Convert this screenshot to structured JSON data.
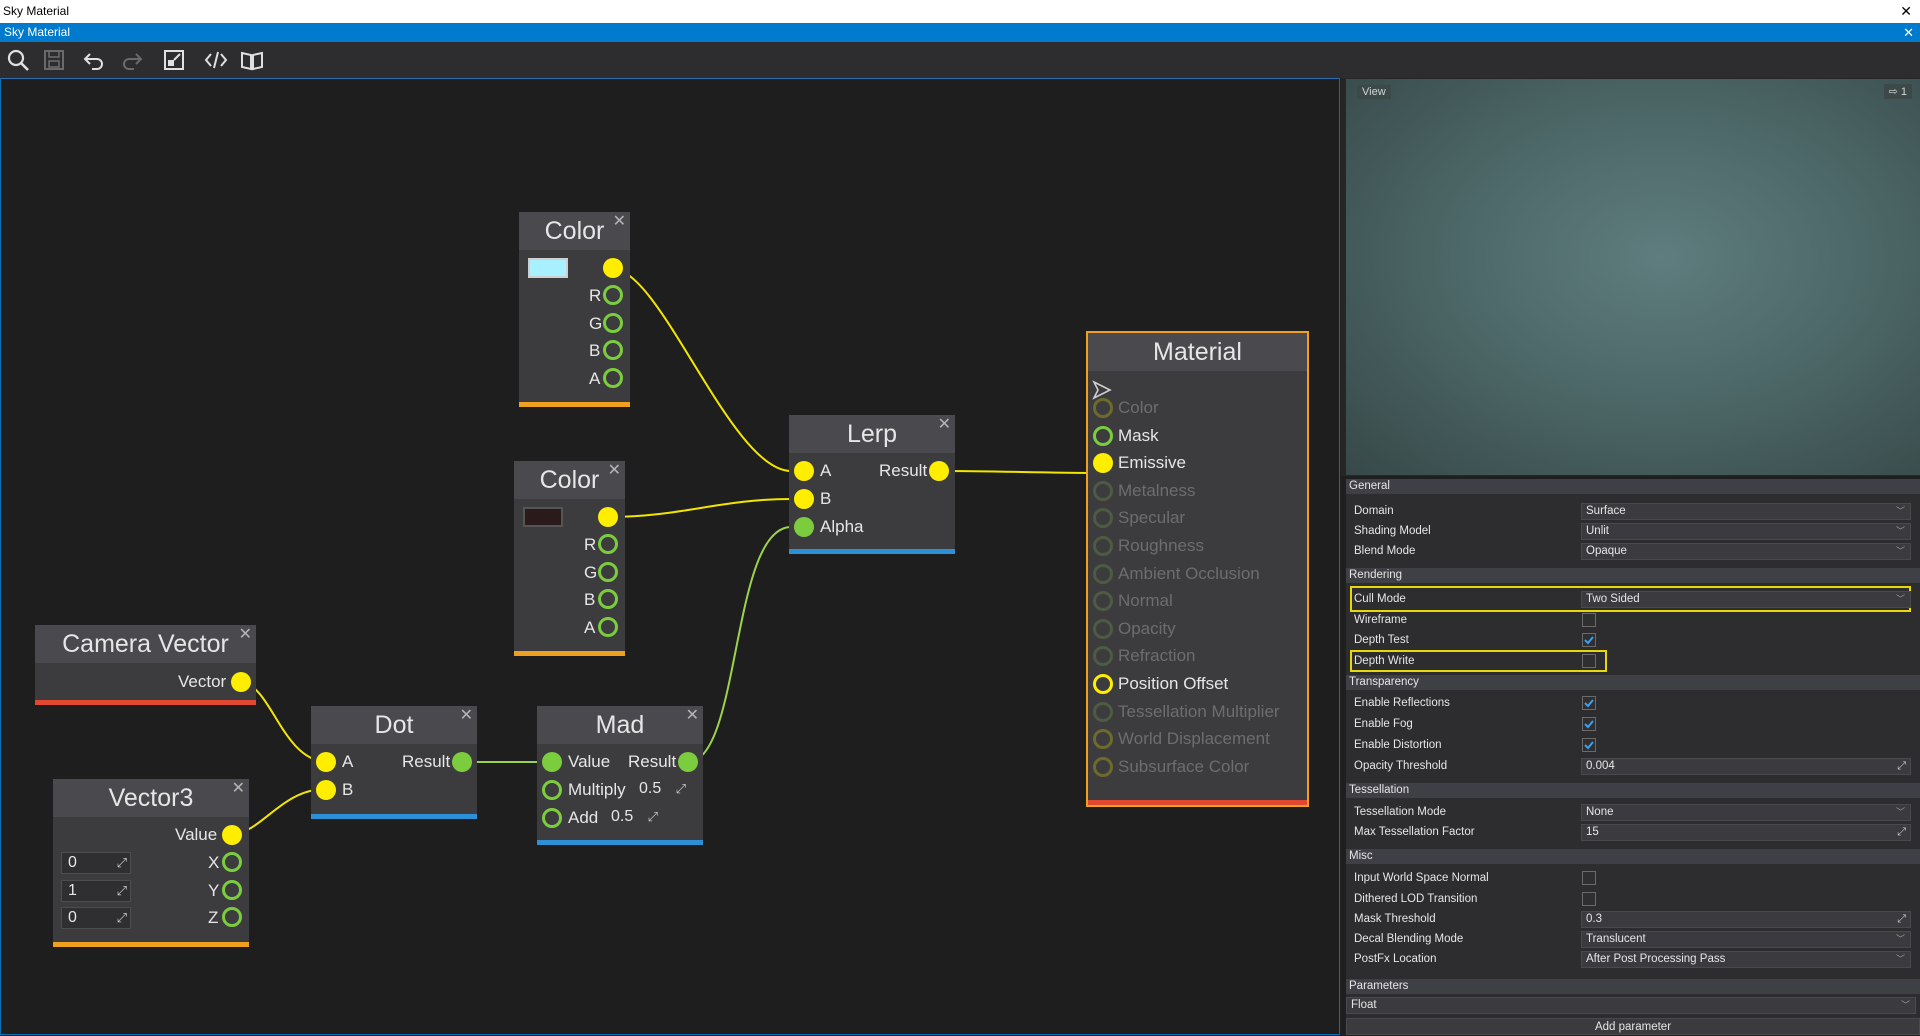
{
  "window": {
    "title": "Sky Material",
    "tab": "Sky Material"
  },
  "toolbar": {
    "icons": [
      "search-icon",
      "save-icon",
      "undo-icon",
      "redo-icon",
      "fit-view-icon",
      "code-icon",
      "docs-icon"
    ]
  },
  "nodes": {
    "color1": {
      "title": "Color",
      "swatch": "#a8f0ff",
      "pins": [
        "R",
        "G",
        "B",
        "A"
      ]
    },
    "color2": {
      "title": "Color",
      "swatch": "#2a1a1c",
      "pins": [
        "R",
        "G",
        "B",
        "A"
      ]
    },
    "lerp": {
      "title": "Lerp",
      "in_a": "A",
      "in_b": "B",
      "in_alpha": "Alpha",
      "out": "Result"
    },
    "camera": {
      "title": "Camera Vector",
      "out": "Vector"
    },
    "dot": {
      "title": "Dot",
      "in_a": "A",
      "in_b": "B",
      "out": "Result"
    },
    "mad": {
      "title": "Mad",
      "in_value": "Value",
      "out": "Result",
      "multiply_label": "Multiply",
      "multiply": "0.5",
      "add_label": "Add",
      "add": "0.5"
    },
    "vector3": {
      "title": "Vector3",
      "out": "Value",
      "x_label": "X",
      "y_label": "Y",
      "z_label": "Z",
      "x": "0",
      "y": "1",
      "z": "0"
    },
    "material": {
      "title": "Material",
      "inputs": [
        {
          "label": "Color",
          "active": false
        },
        {
          "label": "Mask",
          "active": true
        },
        {
          "label": "Emissive",
          "active": true
        },
        {
          "label": "Metalness",
          "active": false
        },
        {
          "label": "Specular",
          "active": false
        },
        {
          "label": "Roughness",
          "active": false
        },
        {
          "label": "Ambient Occlusion",
          "active": false
        },
        {
          "label": "Normal",
          "active": false
        },
        {
          "label": "Opacity",
          "active": false
        },
        {
          "label": "Refraction",
          "active": false
        },
        {
          "label": "Position Offset",
          "active": true
        },
        {
          "label": "Tessellation Multiplier",
          "active": false
        },
        {
          "label": "World Displacement",
          "active": false
        },
        {
          "label": "Subsurface Color",
          "active": false
        }
      ]
    }
  },
  "view": {
    "label": "View",
    "selector": "1"
  },
  "properties": {
    "general": {
      "header": "General",
      "domain_label": "Domain",
      "domain": "Surface",
      "shading_label": "Shading Model",
      "shading": "Unlit",
      "blend_label": "Blend Mode",
      "blend": "Opaque"
    },
    "rendering": {
      "header": "Rendering",
      "cull_label": "Cull Mode",
      "cull": "Two Sided",
      "wireframe_label": "Wireframe",
      "wireframe": false,
      "depth_test_label": "Depth Test",
      "depth_test": true,
      "depth_write_label": "Depth Write",
      "depth_write": false
    },
    "transparency": {
      "header": "Transparency",
      "reflections_label": "Enable Reflections",
      "reflections": true,
      "fog_label": "Enable Fog",
      "fog": true,
      "distortion_label": "Enable Distortion",
      "distortion": true,
      "opacity_threshold_label": "Opacity Threshold",
      "opacity_threshold": "0.004"
    },
    "tessellation": {
      "header": "Tessellation",
      "mode_label": "Tessellation Mode",
      "mode": "None",
      "max_label": "Max Tessellation Factor",
      "max": "15"
    },
    "misc": {
      "header": "Misc",
      "input_ws_normal_label": "Input World Space Normal",
      "input_ws_normal": false,
      "dithered_lod_label": "Dithered LOD Transition",
      "dithered_lod": false,
      "mask_threshold_label": "Mask Threshold",
      "mask_threshold": "0.3",
      "decal_label": "Decal Blending Mode",
      "decal": "Translucent",
      "postfx_label": "PostFx Location",
      "postfx": "After Post Processing Pass"
    },
    "parameters": {
      "header": "Parameters",
      "type": "Float",
      "add_button": "Add parameter"
    }
  },
  "colors": {
    "accent": "#007acc",
    "pin_yellow": "#ffee00",
    "pin_green": "#7ccd3e",
    "highlight": "#e6d80a"
  }
}
